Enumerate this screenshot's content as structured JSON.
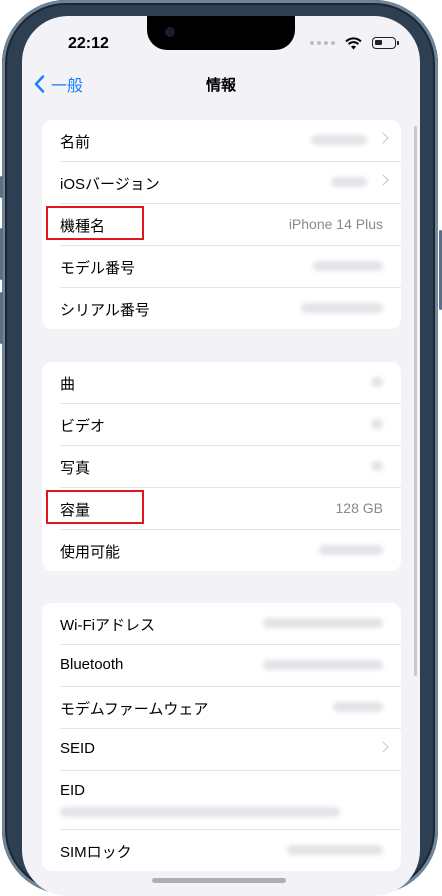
{
  "status": {
    "time": "22:12"
  },
  "nav": {
    "back_label": "一般",
    "title": "情報"
  },
  "group1": [
    {
      "label": "名前",
      "value": "",
      "blurred": true,
      "chevron": true
    },
    {
      "label": "iOSバージョン",
      "value": "",
      "blurred": true,
      "chevron": true
    },
    {
      "label": "機種名",
      "value": "iPhone 14 Plus",
      "highlighted": true
    },
    {
      "label": "モデル番号",
      "value": "",
      "blurred": true
    },
    {
      "label": "シリアル番号",
      "value": "",
      "blurred": true
    }
  ],
  "group2": [
    {
      "label": "曲",
      "value": "",
      "blurred": true
    },
    {
      "label": "ビデオ",
      "value": "",
      "blurred": true
    },
    {
      "label": "写真",
      "value": "",
      "blurred": true
    },
    {
      "label": "容量",
      "value": "128 GB",
      "highlighted": true
    },
    {
      "label": "使用可能",
      "value": "",
      "blurred": true
    }
  ],
  "group3": [
    {
      "label": "Wi-Fiアドレス",
      "value": "",
      "blurred": true
    },
    {
      "label": "Bluetooth",
      "value": "",
      "blurred": true
    },
    {
      "label": "モデムファームウェア",
      "value": "",
      "blurred": true
    },
    {
      "label": "SEID",
      "value": "",
      "chevron": true
    },
    {
      "label": "EID",
      "value": "",
      "blurred": true
    },
    {
      "label": "SIMロック",
      "value": "",
      "blurred": true
    }
  ],
  "colors": {
    "accent": "#1a7ffd",
    "highlight": "#e4141f",
    "background": "#f2f2f7"
  }
}
